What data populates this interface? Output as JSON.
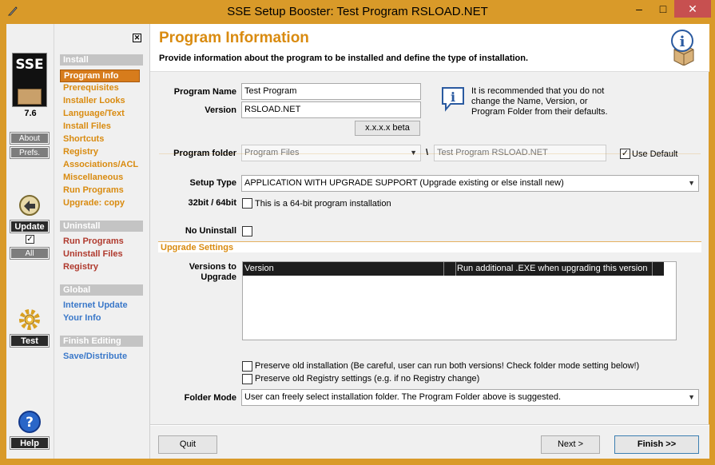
{
  "window": {
    "title": "SSE Setup Booster: Test Program RSLOAD.NET",
    "min": "–",
    "max": "□",
    "close": "✕"
  },
  "strip": {
    "logo": "SSE",
    "version": "7.6",
    "about": "About",
    "prefs": "Prefs.",
    "update": "Update",
    "update_checked": "✓",
    "all": "All",
    "test": "Test",
    "help": "Help"
  },
  "nav": {
    "close": "✕",
    "install_section": "Install",
    "install_items": [
      "Program Info",
      "Prerequisites",
      "Installer Looks",
      "Language/Text",
      "Install Files",
      "Shortcuts",
      "Registry",
      "Associations/ACL",
      "Miscellaneous",
      "Run Programs",
      "Upgrade: copy"
    ],
    "uninstall_section": "Uninstall",
    "uninstall_items": [
      "Run Programs",
      "Uninstall Files",
      "Registry"
    ],
    "global_section": "Global",
    "global_items": [
      "Internet Update",
      "Your Info"
    ],
    "finish_section": "Finish Editing",
    "finish_items": [
      "Save/Distribute"
    ]
  },
  "header": {
    "title": "Program Information",
    "subtitle": "Provide information about the program to be installed and define the type of installation."
  },
  "form": {
    "program_name_label": "Program Name",
    "program_name": "Test Program",
    "version_label": "Version",
    "version": "RSLOAD.NET",
    "version_btn": "x.x.x.x beta",
    "info_note": "It is recommended that you do not change the Name, Version, or Program Folder from their defaults.",
    "program_folder_label": "Program folder",
    "program_folder": "Program Files",
    "backslash": "\\",
    "program_subfolder": "Test Program RSLOAD.NET",
    "use_default_label": "Use Default",
    "use_default_checked": "✓",
    "setup_type_label": "Setup Type",
    "setup_type": "APPLICATION WITH UPGRADE SUPPORT  (Upgrade existing or else install new)",
    "bit_label": "32bit / 64bit",
    "bit_text": "This is a 64-bit program installation",
    "no_uninstall_label": "No Uninstall"
  },
  "upgrade": {
    "section": "Upgrade Settings",
    "versions_label_1": "Versions to",
    "versions_label_2": "Upgrade",
    "columns": [
      "Version",
      "",
      "Run additional .EXE when upgrading this version"
    ],
    "preserve_install": "Preserve old installation (Be careful, user can run both versions! Check folder mode setting below!)",
    "preserve_registry": "Preserve old Registry settings (e.g. if no Registry change)",
    "folder_mode_label": "Folder Mode",
    "folder_mode": "User can freely select installation folder. The Program Folder above is suggested."
  },
  "footer": {
    "quit": "Quit",
    "next": "Next  >",
    "finish": "Finish  >>"
  },
  "colors": {
    "accent": "#d98b10",
    "titlebar": "#d99a29",
    "selected": "#d77c1c"
  }
}
